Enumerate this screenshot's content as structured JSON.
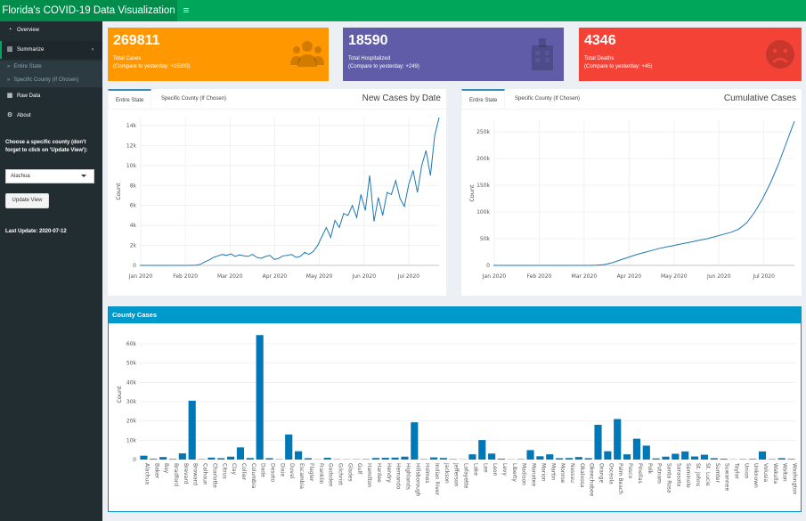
{
  "header": {
    "title": "Florida's COVID-19 Data Visualization",
    "menu_icon": "hamburger-icon"
  },
  "sidebar": {
    "items": [
      {
        "label": "Overview",
        "icon": "dashboard-icon"
      },
      {
        "label": "Summarize",
        "icon": "bar-chart-icon"
      },
      {
        "label": "Raw Data",
        "icon": "table-icon"
      },
      {
        "label": "About",
        "icon": "gear-icon"
      }
    ],
    "sub_items": [
      "Entire State",
      "Specific County (If Chosen)"
    ],
    "county_label": "Choose a specific county (don't forget to click on 'Update View'):",
    "county_value": "Alachua",
    "update_button": "Update View",
    "last_update": "Last Update: 2020-07-12"
  },
  "value_boxes": [
    {
      "value": "269811",
      "title": "Total Cases",
      "subtitle": "(Compare to yesterday: +15300)",
      "color": "#ff9800",
      "icon": "users-icon"
    },
    {
      "value": "18590",
      "title": "Total Hospitalized",
      "subtitle": "(Compare to yesterday: +249)",
      "color": "#605ca8",
      "icon": "hospital-icon"
    },
    {
      "value": "4346",
      "title": "Total Deaths",
      "subtitle": "(Compare to yesterday: +45)",
      "color": "#f44336",
      "icon": "sad-face-icon"
    }
  ],
  "panels": {
    "new_cases": {
      "title": "New Cases by Date",
      "tabs": [
        "Entire State",
        "Specific County (If Chosen)"
      ]
    },
    "cumulative": {
      "title": "Cumulative Cases",
      "tabs": [
        "Entire State",
        "Specific County (If Chosen)"
      ]
    },
    "county": {
      "title": "County Cases"
    }
  },
  "chart_data": [
    {
      "type": "line",
      "ylabel": "Count",
      "xlabel": "",
      "xticks": [
        "Jan 2020",
        "Feb 2020",
        "Mar 2020",
        "Apr 2020",
        "May 2020",
        "Jun 2020",
        "Jul 2020"
      ],
      "yticks": [
        "0",
        "2k",
        "4k",
        "6k",
        "8k",
        "10k",
        "12k",
        "14k"
      ],
      "ylim": [
        0,
        14800
      ],
      "color": "#1f77b4",
      "series": [
        {
          "values": [
            0,
            0,
            0,
            0,
            0,
            0,
            0,
            0,
            0,
            0,
            0,
            0,
            5,
            30,
            120,
            350,
            550,
            800,
            950,
            1100,
            1000,
            1150,
            900,
            1050,
            950,
            900,
            1100,
            800,
            700,
            900,
            1000,
            600,
            700,
            950,
            1000,
            1100,
            800,
            900,
            1300,
            1100,
            1400,
            2000,
            2900,
            3800,
            2800,
            4500,
            3800,
            5200,
            5000,
            6000,
            4800,
            7100,
            5500,
            9000,
            4400,
            6800,
            5000,
            7300,
            7100,
            8500,
            6700,
            5900,
            8100,
            9500,
            7300,
            10000,
            11500,
            9000,
            13000,
            14800
          ]
        }
      ],
      "x_range": [
        "2020-01-01",
        "2020-07-12"
      ]
    },
    {
      "type": "line",
      "ylabel": "Count",
      "xlabel": "",
      "xticks": [
        "Jan 2020",
        "Feb 2020",
        "Mar 2020",
        "Apr 2020",
        "May 2020",
        "Jun 2020",
        "Jul 2020"
      ],
      "yticks": [
        "0",
        "50k",
        "100k",
        "150k",
        "200k",
        "250k"
      ],
      "ylim": [
        0,
        270000
      ],
      "color": "#1f77b4",
      "series": [
        {
          "values": [
            0,
            0,
            0,
            0,
            0,
            0,
            0,
            0,
            0,
            0,
            0,
            0,
            50,
            300,
            1500,
            5000,
            10000,
            15000,
            20000,
            24000,
            28000,
            32000,
            35000,
            38000,
            41000,
            44000,
            47000,
            50000,
            54000,
            58000,
            62000,
            68000,
            80000,
            100000,
            125000,
            155000,
            190000,
            230000,
            269811
          ]
        }
      ],
      "x_range": [
        "2020-01-01",
        "2020-07-12"
      ]
    },
    {
      "type": "bar",
      "ylabel": "Count",
      "xlabel": "",
      "yticks": [
        "0",
        "10k",
        "20k",
        "30k",
        "40k",
        "50k",
        "60k"
      ],
      "ylim": [
        0,
        66000
      ],
      "color": "#0077b6",
      "categories": [
        "Alachua",
        "Baker",
        "Bay",
        "Bradford",
        "Brevard",
        "Broward",
        "Calhoun",
        "Charlotte",
        "Citrus",
        "Clay",
        "Collier",
        "Columbia",
        "Dade",
        "Desoto",
        "Dixie",
        "Duval",
        "Escambia",
        "Flagler",
        "Franklin",
        "Gadsden",
        "Gilchrist",
        "Glades",
        "Gulf",
        "Hamilton",
        "Hardee",
        "Hendry",
        "Hernando",
        "Highlands",
        "Hillsborough",
        "Holmes",
        "Indian River",
        "Jackson",
        "Jefferson",
        "Lafayette",
        "Lake",
        "Lee",
        "Leon",
        "Levy",
        "Liberty",
        "Madison",
        "Manatee",
        "Marion",
        "Martin",
        "Monroe",
        "Nassau",
        "Okaloosa",
        "Okeechobee",
        "Orange",
        "Osceola",
        "Palm Beach",
        "Pasco",
        "Pinellas",
        "Polk",
        "Putnam",
        "Santa Rosa",
        "Sarasota",
        "Seminole",
        "St. Johns",
        "St. Lucie",
        "Sumter",
        "Suwannee",
        "Taylor",
        "Union",
        "Unknown",
        "Volusia",
        "Wakulla",
        "Walton",
        "Washington"
      ],
      "values": [
        2000,
        400,
        1300,
        300,
        3200,
        30500,
        200,
        1000,
        700,
        1500,
        6300,
        800,
        64500,
        700,
        150,
        13000,
        4300,
        700,
        100,
        900,
        150,
        100,
        150,
        200,
        800,
        900,
        1000,
        1500,
        19300,
        200,
        1100,
        800,
        200,
        100,
        2700,
        10100,
        3100,
        400,
        100,
        200,
        4900,
        1700,
        2700,
        700,
        800,
        1300,
        700,
        18000,
        4300,
        21000,
        2700,
        10800,
        7200,
        600,
        1500,
        3000,
        4200,
        1600,
        2500,
        700,
        400,
        100,
        200,
        300,
        4200,
        200,
        700,
        300
      ]
    }
  ]
}
